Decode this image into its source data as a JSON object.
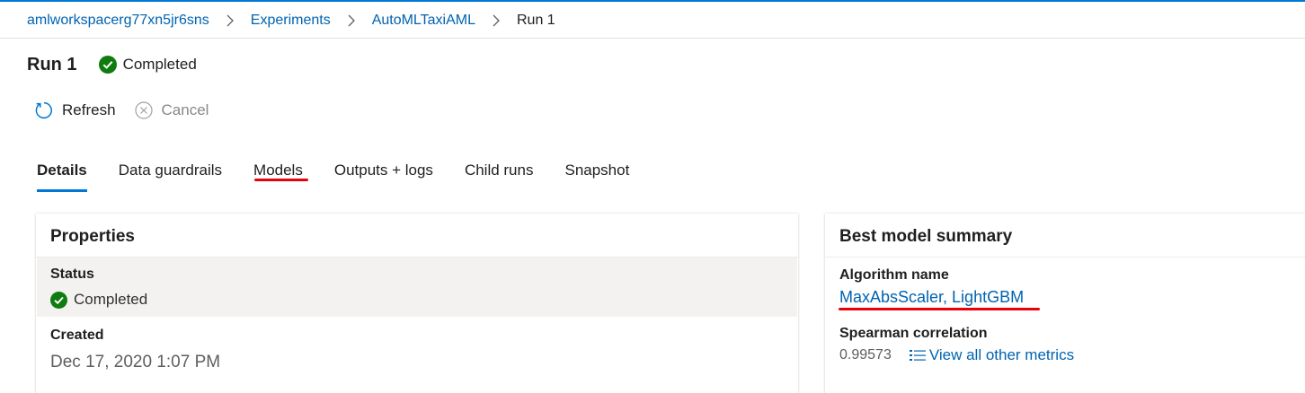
{
  "breadcrumb": {
    "items": [
      {
        "label": "amlworkspacerg77xn5jr6sns"
      },
      {
        "label": "Experiments"
      },
      {
        "label": "AutoMLTaxiAML"
      }
    ],
    "current": "Run 1",
    "separator_icon": "chevron-right-icon"
  },
  "header": {
    "title": "Run 1",
    "status": "Completed",
    "status_icon": "check-circle-icon",
    "status_color": "#107c10"
  },
  "commands": {
    "refresh_label": "Refresh",
    "refresh_icon": "refresh-icon",
    "cancel_label": "Cancel",
    "cancel_icon": "cancel-circle-icon"
  },
  "tabs": [
    {
      "label": "Details",
      "active": true
    },
    {
      "label": "Data guardrails",
      "active": false
    },
    {
      "label": "Models",
      "active": false
    },
    {
      "label": "Outputs + logs",
      "active": false
    },
    {
      "label": "Child runs",
      "active": false
    },
    {
      "label": "Snapshot",
      "active": false
    }
  ],
  "properties": {
    "title": "Properties",
    "status_label": "Status",
    "status_value": "Completed",
    "created_label": "Created",
    "created_value": "Dec 17, 2020 1:07 PM"
  },
  "best_model": {
    "title": "Best model summary",
    "algorithm_label": "Algorithm name",
    "algorithm_value": "MaxAbsScaler, LightGBM",
    "metric_label": "Spearman correlation",
    "metric_value": "0.99573",
    "view_metrics_label": "View all other metrics"
  },
  "colors": {
    "accent": "#0078d4",
    "link": "#0063b1",
    "success": "#107c10",
    "annotation_red": "#e8000b"
  }
}
